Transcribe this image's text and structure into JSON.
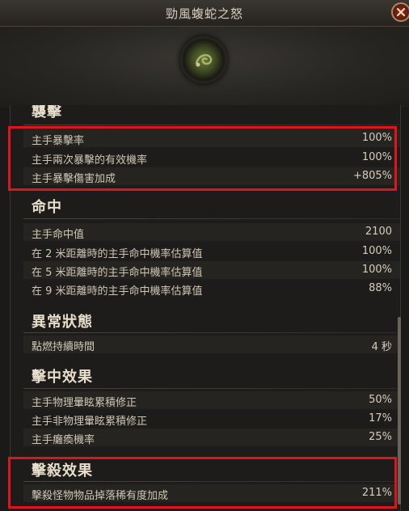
{
  "window": {
    "title": "勁風蝮蛇之怒"
  },
  "sections": {
    "s0": {
      "title": "襲擊",
      "rows": [
        {
          "label": "主手暴擊率",
          "value": "100%"
        },
        {
          "label": "主手兩次暴擊的有效機率",
          "value": "100%"
        },
        {
          "label": "主手暴擊傷害加成",
          "value": "+805%"
        }
      ]
    },
    "s1": {
      "title": "命中",
      "rows": [
        {
          "label": "主手命中值",
          "value": "2100"
        },
        {
          "label": "在 2 米距離時的主手命中機率估算值",
          "value": "100%"
        },
        {
          "label": "在 5 米距離時的主手命中機率估算值",
          "value": "100%"
        },
        {
          "label": "在 9 米距離時的主手命中機率估算值",
          "value": "88%"
        }
      ]
    },
    "s2": {
      "title": "異常狀態",
      "rows": [
        {
          "label": "點燃持續時間",
          "value": "4 秒"
        }
      ]
    },
    "s3": {
      "title": "擊中效果",
      "rows": [
        {
          "label": "主手物理暈眩累積修正",
          "value": "50%"
        },
        {
          "label": "主手非物理暈眩累積修正",
          "value": "17%"
        },
        {
          "label": "主手癱瘓機率",
          "value": "25%"
        }
      ]
    },
    "s4": {
      "title": "擊殺效果",
      "rows": [
        {
          "label": "擊殺怪物物品掉落稀有度加成",
          "value": "211%"
        }
      ]
    }
  },
  "icons": {
    "close": "close-icon",
    "emblem": "serpent-emblem-icon"
  },
  "colors": {
    "highlight": "#e0141c",
    "background": "#1b1a18",
    "text": "#cfc6b5"
  }
}
